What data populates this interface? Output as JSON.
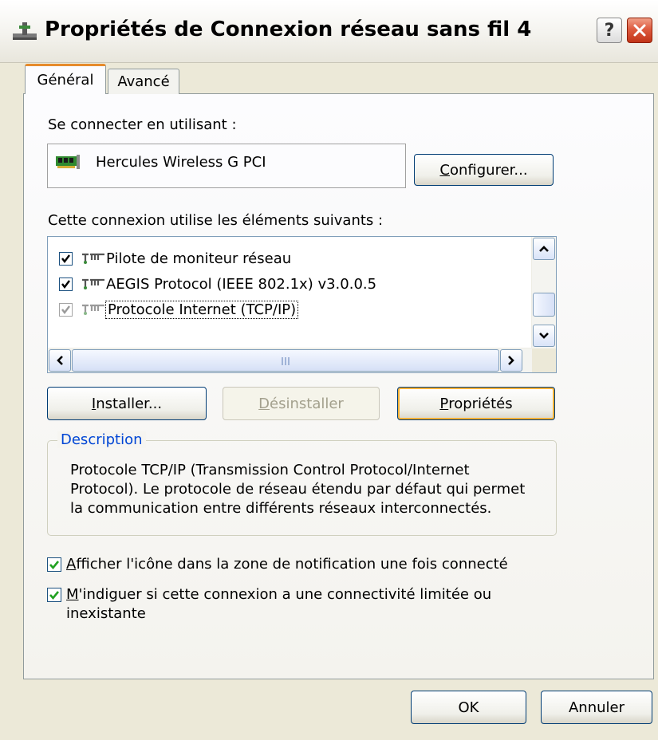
{
  "window": {
    "title": "Propriétés de Connexion réseau sans fil 4",
    "help_label": "?"
  },
  "tabs": [
    {
      "label": "Général",
      "active": true
    },
    {
      "label": "Avancé",
      "active": false
    }
  ],
  "connect": {
    "label": "Se connecter en utilisant :",
    "adapter": "Hercules Wireless G PCI",
    "configure": {
      "before": "",
      "mnemonic": "C",
      "after": "onfigurer..."
    }
  },
  "components": {
    "label": "Cette connexion utilise les éléments suivants :",
    "items": [
      {
        "label": "Pilote de moniteur réseau",
        "checked": true
      },
      {
        "label": "AEGIS Protocol (IEEE 802.1x) v3.0.0.5",
        "checked": true
      },
      {
        "label": "Protocole Internet (TCP/IP)",
        "checked": true,
        "selected": true
      }
    ]
  },
  "buttons": {
    "install": {
      "before": "",
      "mnemonic": "I",
      "after": "nstaller..."
    },
    "uninstall": {
      "before": "",
      "mnemonic": "D",
      "after": "ésinstaller"
    },
    "properties": {
      "before": "",
      "mnemonic": "P",
      "after": "ropriétés"
    },
    "ok": "OK",
    "cancel": "Annuler"
  },
  "description": {
    "title": "Description",
    "text": "Protocole TCP/IP (Transmission Control Protocol/Internet Protocol). Le protocole de réseau étendu par défaut qui permet la communication entre différents réseaux interconnectés."
  },
  "options": {
    "show_icon": {
      "before": "",
      "mnemonic": "A",
      "after": "fficher l'icône dans la zone de notification une fois connecté",
      "checked": true
    },
    "limited": {
      "before": "",
      "mnemonic": "M",
      "after": "'indiguer si cette connexion a une connectivité limitée ou inexistante",
      "checked": true
    }
  },
  "colors": {
    "accent_tab": "#e68b2c",
    "check": "#21a121",
    "group_title": "#0046d5"
  }
}
